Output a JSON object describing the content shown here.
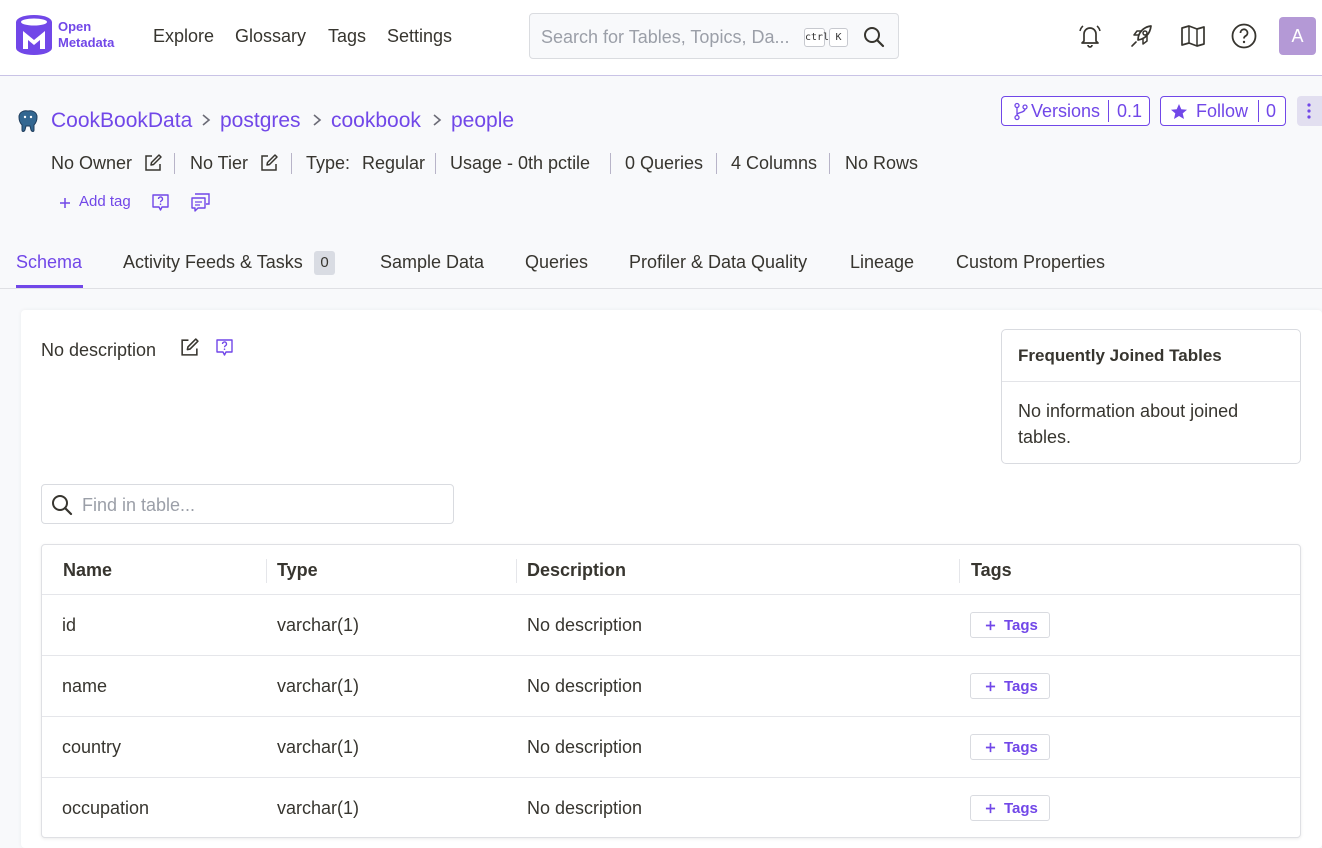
{
  "nav": {
    "logo_line1": "Open",
    "logo_line2": "Metadata",
    "links": [
      "Explore",
      "Glossary",
      "Tags",
      "Settings"
    ],
    "search_placeholder": "Search for Tables, Topics, Da...",
    "kbd_ctrl": "ctrl",
    "kbd_k": "K",
    "avatar_letter": "A"
  },
  "header": {
    "breadcrumb": [
      "CookBookData",
      "postgres",
      "cookbook",
      "people"
    ],
    "versions_label": "Versions",
    "versions_value": "0.1",
    "follow_label": "Follow",
    "follow_count": "0",
    "meta": {
      "owner": "No Owner",
      "tier": "No Tier",
      "type_label": "Type:",
      "type_value": "Regular",
      "usage": "Usage - 0th pctile",
      "queries": "0 Queries",
      "columns": "4 Columns",
      "rows": "No Rows"
    },
    "add_tag": "Add tag"
  },
  "tabs": [
    {
      "label": "Schema",
      "active": true
    },
    {
      "label": "Activity Feeds & Tasks",
      "badge": "0"
    },
    {
      "label": "Sample Data"
    },
    {
      "label": "Queries"
    },
    {
      "label": "Profiler & Data Quality"
    },
    {
      "label": "Lineage"
    },
    {
      "label": "Custom Properties"
    }
  ],
  "schema": {
    "description": "No description",
    "joined_title": "Frequently Joined Tables",
    "joined_body": "No information about joined tables.",
    "find_placeholder": "Find in table...",
    "columns": [
      "Name",
      "Type",
      "Description",
      "Tags"
    ],
    "rows": [
      {
        "name": "id",
        "type": "varchar(1)",
        "description": "No description",
        "tags": "Tags"
      },
      {
        "name": "name",
        "type": "varchar(1)",
        "description": "No description",
        "tags": "Tags"
      },
      {
        "name": "country",
        "type": "varchar(1)",
        "description": "No description",
        "tags": "Tags"
      },
      {
        "name": "occupation",
        "type": "varchar(1)",
        "description": "No description",
        "tags": "Tags"
      }
    ]
  },
  "colors": {
    "accent": "#7147e8",
    "avatar": "#b499d6"
  },
  "icons": [
    "logo-icon",
    "search-icon",
    "bell-icon",
    "rocket-icon",
    "map-icon",
    "help-icon",
    "postgres-icon",
    "chevron-right-icon",
    "branch-icon",
    "star-icon",
    "more-icon",
    "edit-icon",
    "request-description-icon",
    "conversation-icon",
    "plus-icon"
  ]
}
